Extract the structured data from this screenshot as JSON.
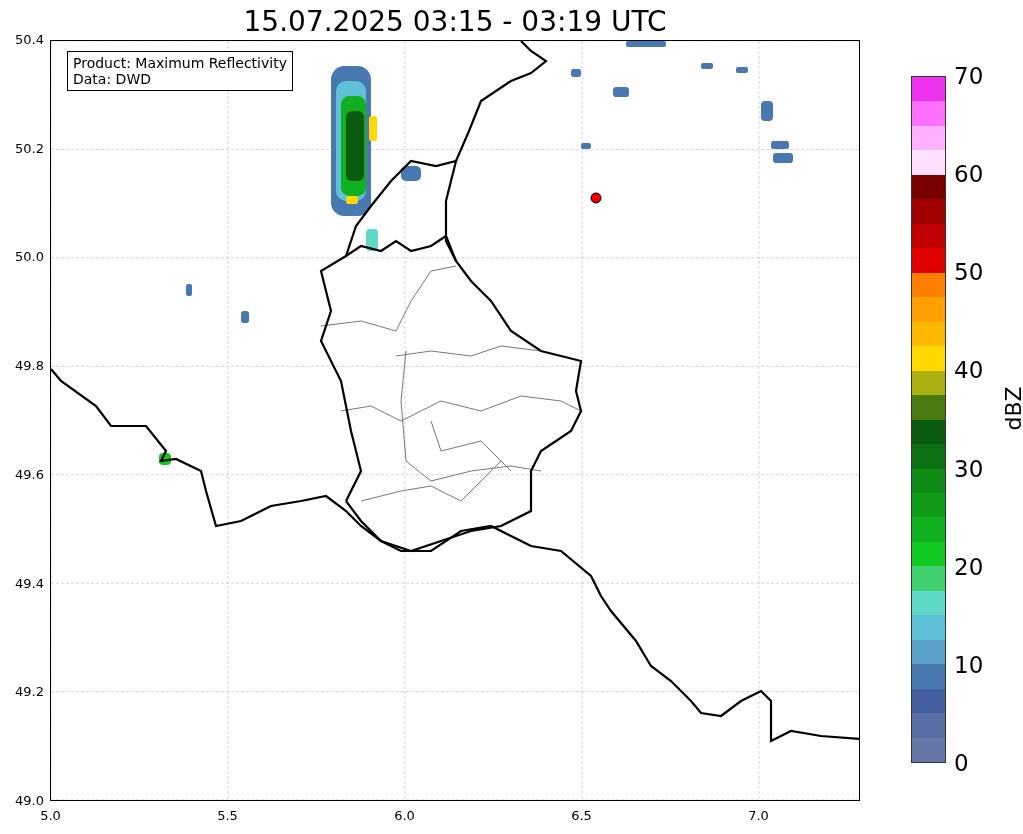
{
  "title": "15.07.2025 03:15 - 03:19 UTC",
  "map": {
    "legend": [
      "Product: Maximum Reflectivity",
      "Data: DWD"
    ],
    "xticks": [
      "5.0",
      "5.5",
      "6.0",
      "6.5",
      "7.0"
    ],
    "yticks": [
      "50.4",
      "50.2",
      "50.0",
      "49.8",
      "49.6",
      "49.4",
      "49.2",
      "49.0"
    ]
  },
  "colorbar": {
    "label": "dBZ",
    "ticks": [
      "70",
      "60",
      "50",
      "40",
      "30",
      "20",
      "10",
      "0"
    ],
    "bins": [
      {
        "color": "#ee33ee"
      },
      {
        "color": "#ff70ff"
      },
      {
        "color": "#ffb0ff"
      },
      {
        "color": "#ffe0ff"
      },
      {
        "color": "#780000"
      },
      {
        "color": "#a00000"
      },
      {
        "color": "#c00000"
      },
      {
        "color": "#e00000"
      },
      {
        "color": "#ff8000"
      },
      {
        "color": "#ffa000"
      },
      {
        "color": "#ffb800"
      },
      {
        "color": "#ffd800"
      },
      {
        "color": "#aab010"
      },
      {
        "color": "#4a7a10"
      },
      {
        "color": "#0a5a0f"
      },
      {
        "color": "#0d7015"
      },
      {
        "color": "#0f8a15"
      },
      {
        "color": "#109c18"
      },
      {
        "color": "#10b020"
      },
      {
        "color": "#10c820"
      },
      {
        "color": "#40d070"
      },
      {
        "color": "#60d8c8"
      },
      {
        "color": "#60c0d8"
      },
      {
        "color": "#5aa0c8"
      },
      {
        "color": "#4878b0"
      },
      {
        "color": "#4560a0"
      },
      {
        "color": "#5a6ea6"
      },
      {
        "color": "#6577a8"
      }
    ]
  }
}
